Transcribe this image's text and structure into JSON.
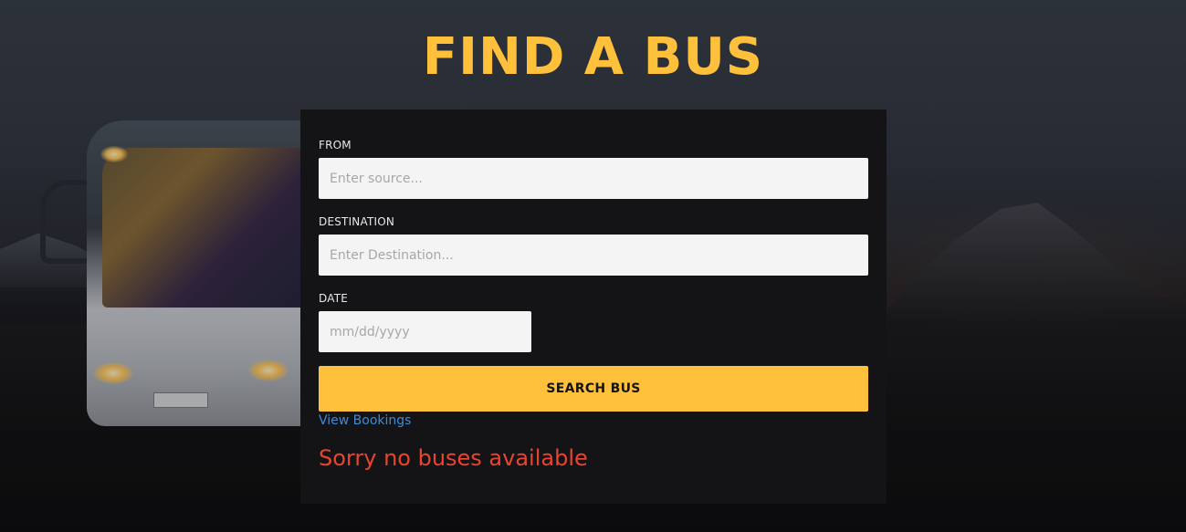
{
  "header": {
    "title": "FIND A BUS"
  },
  "form": {
    "from": {
      "label": "FROM",
      "placeholder": "Enter source..."
    },
    "destination": {
      "label": "DESTINATION",
      "placeholder": "Enter Destination..."
    },
    "date": {
      "label": "DATE",
      "placeholder": "mm/dd/yyyy"
    },
    "search_button_label": "SEARCH BUS",
    "view_bookings_label": "View Bookings",
    "status_message": "Sorry no buses available"
  },
  "colors": {
    "accent": "#ffc13b",
    "card_background": "#141416",
    "link": "#3d8bd6",
    "error": "#e8442e",
    "input_background": "#f4f4f4"
  }
}
